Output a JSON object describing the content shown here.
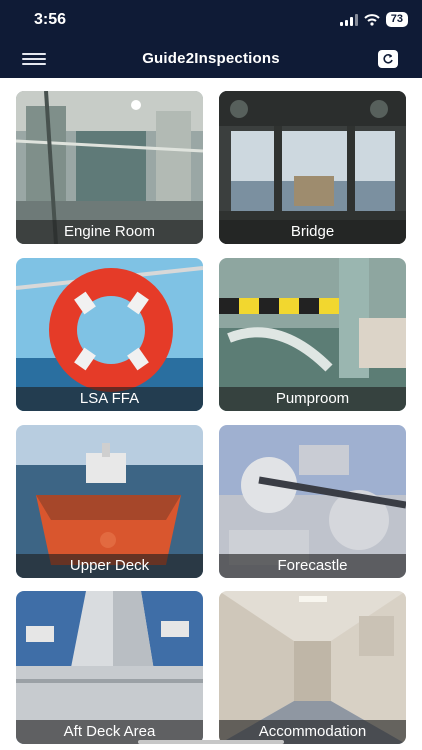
{
  "status": {
    "time": "3:56",
    "battery": "73"
  },
  "nav": {
    "title": "Guide2Inspections"
  },
  "tiles": [
    {
      "label": "Engine Room"
    },
    {
      "label": "Bridge"
    },
    {
      "label": "LSA FFA"
    },
    {
      "label": "Pumproom"
    },
    {
      "label": "Upper Deck"
    },
    {
      "label": "Forecastle"
    },
    {
      "label": "Aft Deck Area"
    },
    {
      "label": "Accommodation"
    }
  ],
  "icons": {
    "menu": "hamburger-icon",
    "refresh": "refresh-icon"
  },
  "colors": {
    "header": "#0f1b36",
    "caption_overlay": "rgba(30,30,30,0.62)"
  }
}
